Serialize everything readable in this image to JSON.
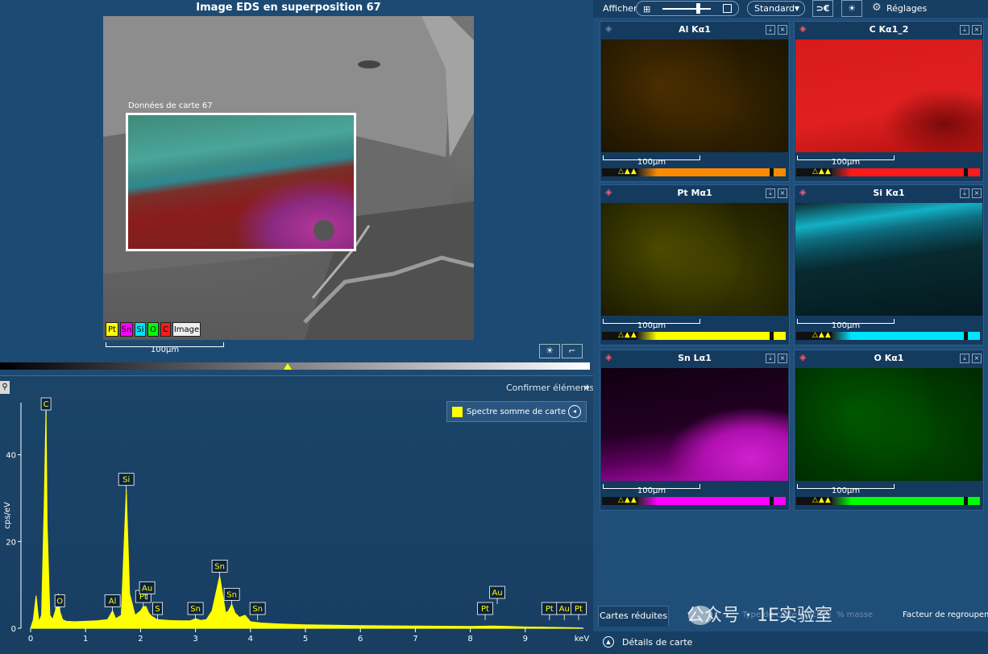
{
  "overlay": {
    "title": "Image EDS en superposition 67",
    "roi_label": "Données de carte 67",
    "scalebar": "100µm",
    "legend": [
      {
        "label": "Pt",
        "color": "#ffff00"
      },
      {
        "label": "Sn",
        "color": "#ff00ff"
      },
      {
        "label": "Si",
        "color": "#00e5ff"
      },
      {
        "label": "O",
        "color": "#00ff00"
      },
      {
        "label": "C",
        "color": "#ff1a1a"
      },
      {
        "label": "Image",
        "color": "#ffffff"
      }
    ]
  },
  "spectrum": {
    "confirm_label": "Confirmer éléments",
    "confirm_arrows": "»",
    "legend_label": "Spectre somme de carte",
    "series_color": "#ffff00"
  },
  "chart_data": {
    "type": "area",
    "xlabel": "keV",
    "ylabel": "cps/eV",
    "xlim": [
      0,
      10
    ],
    "ylim": [
      0,
      52
    ],
    "xticks": [
      0,
      1,
      2,
      3,
      4,
      5,
      6,
      7,
      8,
      9
    ],
    "yticks": [
      0,
      20,
      40
    ],
    "x": [
      0.0,
      0.05,
      0.1,
      0.15,
      0.2,
      0.25,
      0.28,
      0.3,
      0.35,
      0.4,
      0.45,
      0.5,
      0.53,
      0.58,
      0.65,
      0.8,
      1.0,
      1.2,
      1.4,
      1.49,
      1.55,
      1.65,
      1.74,
      1.8,
      1.9,
      2.0,
      2.05,
      2.1,
      2.15,
      2.2,
      2.3,
      2.5,
      2.7,
      2.9,
      3.0,
      3.1,
      3.2,
      3.3,
      3.44,
      3.55,
      3.6,
      3.66,
      3.72,
      3.8,
      3.9,
      4.0,
      4.2,
      4.5,
      5.0,
      6.0,
      7.0,
      8.0,
      8.4,
      8.7,
      9.0,
      9.5,
      10.0
    ],
    "y": [
      0.0,
      2.0,
      7.5,
      1.5,
      3.0,
      30.0,
      51.0,
      24.0,
      3.0,
      2.0,
      4.0,
      8.0,
      4.0,
      2.0,
      1.6,
      1.5,
      1.6,
      1.7,
      2.0,
      4.0,
      2.2,
      3.0,
      32.0,
      8.0,
      3.0,
      4.0,
      5.0,
      5.0,
      3.5,
      2.8,
      2.0,
      1.8,
      1.7,
      1.7,
      2.2,
      1.8,
      2.0,
      4.0,
      12.0,
      3.5,
      4.0,
      5.5,
      3.5,
      2.5,
      3.0,
      1.5,
      1.2,
      1.0,
      0.8,
      0.6,
      0.5,
      0.4,
      0.5,
      0.4,
      0.3,
      0.2,
      0.1
    ],
    "peak_labels": [
      {
        "label": "C",
        "x": 0.28
      },
      {
        "label": "O",
        "x": 0.53
      },
      {
        "label": "Al",
        "x": 1.49
      },
      {
        "label": "Si",
        "x": 1.74
      },
      {
        "label": "Pt",
        "x": 2.05
      },
      {
        "label": "Au",
        "x": 2.12
      },
      {
        "label": "S",
        "x": 2.31
      },
      {
        "label": "Sn",
        "x": 3.0
      },
      {
        "label": "Sn",
        "x": 3.44
      },
      {
        "label": "Sn",
        "x": 3.66
      },
      {
        "label": "Sn",
        "x": 4.13
      },
      {
        "label": "Pt",
        "x": 8.27
      },
      {
        "label": "Au",
        "x": 8.49
      },
      {
        "label": "Pt",
        "x": 9.44
      },
      {
        "label": "Au",
        "x": 9.71
      },
      {
        "label": "Pt",
        "x": 9.97
      }
    ]
  },
  "toolbar": {
    "afficher": "Afficher",
    "mode": "Standard",
    "settings": "Réglages",
    "grid_icon": "grid-icon",
    "contrast_icon": "brightness-icon"
  },
  "maps": [
    {
      "title": "Al Kα1",
      "color": "#ff8a00",
      "scalebar": "100µm",
      "base": "#1a1400",
      "hasLayer": false
    },
    {
      "title": "C Kα1_2",
      "color": "#ff1a1a",
      "scalebar": "100µm",
      "base": "#e01414",
      "hasLayer": true
    },
    {
      "title": "Pt Mα1",
      "color": "#ffff00",
      "scalebar": "100µm",
      "base": "#1b1a00",
      "hasLayer": true
    },
    {
      "title": "Si Kα1",
      "color": "#00e5ff",
      "scalebar": "100µm",
      "base": "#002a30",
      "hasLayer": true
    },
    {
      "title": "Sn Lα1",
      "color": "#ff00ff",
      "scalebar": "100µm",
      "base": "#150015",
      "hasLayer": true
    },
    {
      "title": "O Kα1",
      "color": "#00ff00",
      "scalebar": "100µm",
      "base": "#002a00",
      "hasLayer": true
    }
  ],
  "bottom": {
    "tab_reduced": "Cartes réduites",
    "type_label": "Type de carte affichée",
    "pct_label": "% masse",
    "factor_label": "Facteur de regroupem",
    "details_label": "Détails de carte",
    "watermark": "公众号 · 1E实验室"
  }
}
